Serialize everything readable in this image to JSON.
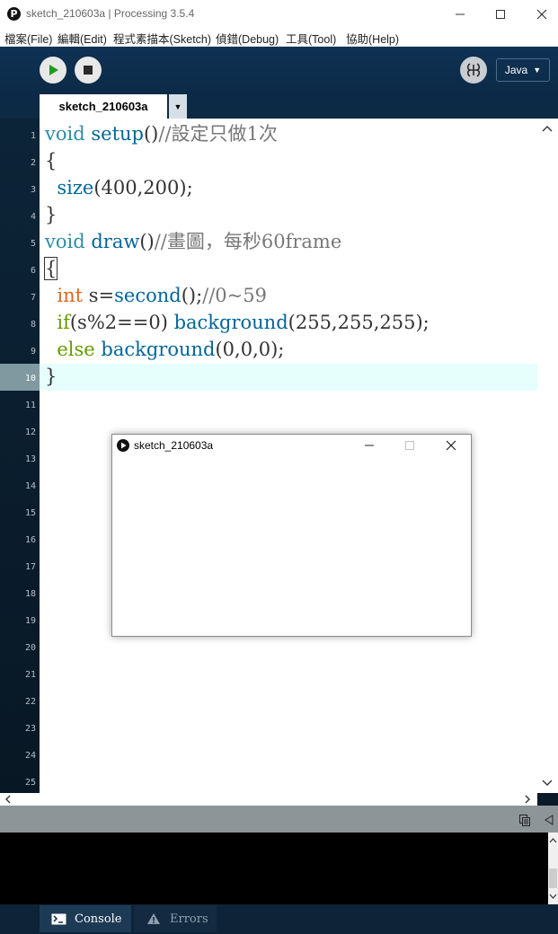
{
  "window": {
    "title": "sketch_210603a | Processing 3.5.4",
    "app_icon": "P"
  },
  "menu": [
    {
      "label": "檔案(File)"
    },
    {
      "label": "編輯(Edit)"
    },
    {
      "label": "程式素描本(Sketch)"
    },
    {
      "label": "偵錯(Debug)"
    },
    {
      "label": "工具(Tool)"
    },
    {
      "label": "協助(Help)"
    }
  ],
  "toolbar": {
    "mode": "Java",
    "mode_arrow": "▼",
    "icons": [
      "run-icon",
      "stop-icon",
      "debugger-icon"
    ]
  },
  "tab": {
    "label": "sketch_210603a",
    "menu_arrow": "▼"
  },
  "editor": {
    "current_line": 10,
    "line_numbers": [
      "1",
      "2",
      "3",
      "4",
      "5",
      "6",
      "7",
      "8",
      "9",
      "10",
      "11",
      "12",
      "13",
      "14",
      "15",
      "16",
      "17",
      "18",
      "19",
      "20",
      "21",
      "22",
      "23",
      "24",
      "25"
    ],
    "lines": [
      [
        {
          "t": "void",
          "c": "kw"
        },
        {
          "t": " "
        },
        {
          "t": "setup",
          "c": "fn"
        },
        {
          "t": "()"
        },
        {
          "t": "//設定只做1次",
          "c": "cm"
        }
      ],
      [
        {
          "t": "{"
        }
      ],
      [
        {
          "t": "  "
        },
        {
          "t": "size",
          "c": "fn"
        },
        {
          "t": "(400,200);"
        }
      ],
      [
        {
          "t": "}"
        }
      ],
      [
        {
          "t": "void",
          "c": "kw"
        },
        {
          "t": " "
        },
        {
          "t": "draw",
          "c": "fn"
        },
        {
          "t": "()"
        },
        {
          "t": "//畫圖，每秒60frame",
          "c": "cm"
        }
      ],
      [
        {
          "t": "{",
          "c": "box"
        }
      ],
      [
        {
          "t": "  "
        },
        {
          "t": "int",
          "c": "ty"
        },
        {
          "t": " s="
        },
        {
          "t": "second",
          "c": "fn"
        },
        {
          "t": "();"
        },
        {
          "t": "//0~59",
          "c": "cm"
        }
      ],
      [
        {
          "t": "  "
        },
        {
          "t": "if",
          "c": "kw2"
        },
        {
          "t": "(s%2==0) "
        },
        {
          "t": "background",
          "c": "fn"
        },
        {
          "t": "(255,255,255);"
        }
      ],
      [
        {
          "t": "  "
        },
        {
          "t": "else",
          "c": "kw2"
        },
        {
          "t": " "
        },
        {
          "t": "background",
          "c": "fn"
        },
        {
          "t": "(0,0,0);"
        }
      ],
      [
        {
          "t": "}"
        }
      ]
    ]
  },
  "footer": {
    "console_label": "Console",
    "errors_label": "Errors"
  },
  "sketch_window": {
    "title": "sketch_210603a"
  }
}
